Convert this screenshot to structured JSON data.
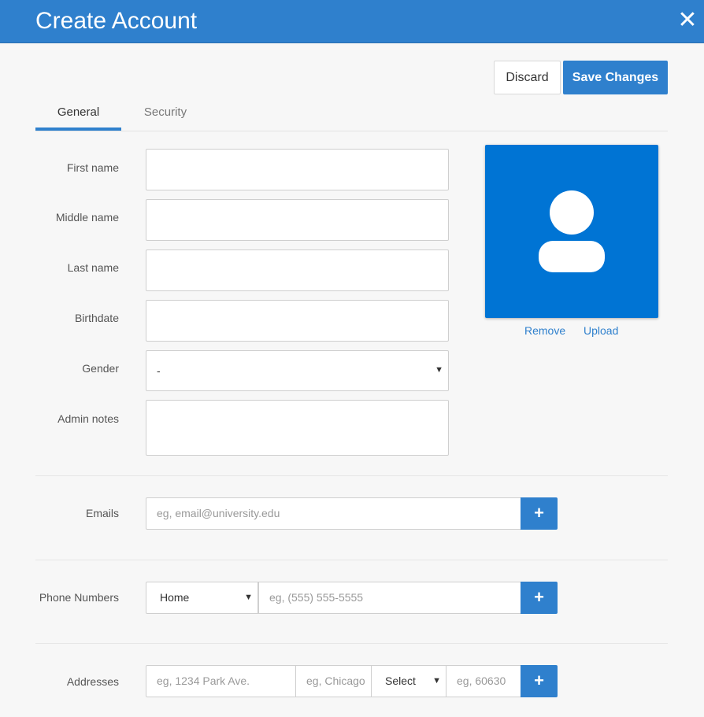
{
  "header": {
    "title": "Create Account",
    "close_icon": "close-icon"
  },
  "actions": {
    "discard": "Discard",
    "save": "Save Changes"
  },
  "tabs": [
    {
      "label": "General",
      "active": true
    },
    {
      "label": "Security",
      "active": false
    }
  ],
  "form": {
    "first_name": {
      "label": "First name",
      "value": ""
    },
    "middle_name": {
      "label": "Middle name",
      "value": ""
    },
    "last_name": {
      "label": "Last name",
      "value": ""
    },
    "birthdate": {
      "label": "Birthdate",
      "value": ""
    },
    "gender": {
      "label": "Gender",
      "value": "-"
    },
    "admin_notes": {
      "label": "Admin notes",
      "value": ""
    }
  },
  "avatar": {
    "remove": "Remove",
    "upload": "Upload",
    "color": "#0074d4"
  },
  "emails": {
    "label": "Emails",
    "placeholder": "eg, email@university.edu",
    "add": "+"
  },
  "phones": {
    "label": "Phone Numbers",
    "type": "Home",
    "placeholder": "eg, (555) 555-5555",
    "add": "+"
  },
  "addresses": {
    "label": "Addresses",
    "street_placeholder": "eg, 1234 Park Ave.",
    "city_placeholder": "eg, Chicago",
    "state": "Select",
    "zip_placeholder": "eg, 60630",
    "add": "+"
  },
  "colors": {
    "accent": "#2f80cd",
    "background": "#f7f7f7"
  }
}
